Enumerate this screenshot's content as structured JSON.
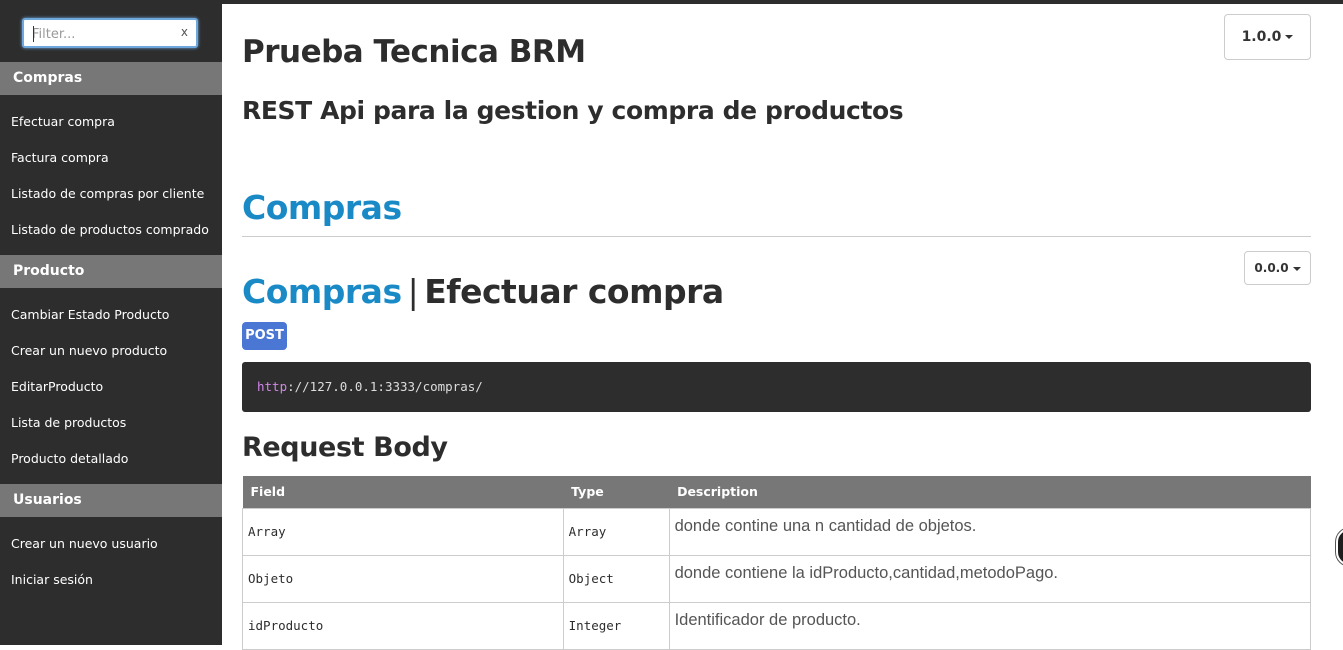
{
  "sidebar": {
    "filter_placeholder": "Filter...",
    "filter_clear": "x",
    "groups": [
      {
        "title": "Compras",
        "items": [
          "Efectuar compra",
          "Factura compra",
          "Listado de compras por cliente",
          "Listado de productos comprado"
        ]
      },
      {
        "title": "Producto",
        "items": [
          "Cambiar Estado Producto",
          "Crear un nuevo producto",
          "EditarProducto",
          "Lista de productos",
          "Producto detallado"
        ]
      },
      {
        "title": "Usuarios",
        "items": [
          "Crear un nuevo usuario",
          "Iniciar sesión"
        ]
      }
    ]
  },
  "header": {
    "title": "Prueba Tecnica BRM",
    "subtitle": "REST Api para la gestion y compra de productos",
    "version": "1.0.0"
  },
  "section": {
    "title": "Compras"
  },
  "endpoint": {
    "group": "Compras",
    "separator": "|",
    "name": "Efectuar compra",
    "version": "0.0.0",
    "method": "POST",
    "url_scheme": "http",
    "url_rest": "://127.0.0.1:3333/compras/",
    "request_body_title": "Request Body",
    "table": {
      "headers": [
        "Field",
        "Type",
        "Description"
      ],
      "rows": [
        {
          "field": "Array",
          "type": "Array",
          "description": "donde contine una n cantidad de objetos."
        },
        {
          "field": "Objeto",
          "type": "Object",
          "description": "donde contiene la idProducto,cantidad,metodoPago."
        },
        {
          "field": "idProducto",
          "type": "Integer",
          "description": "Identificador de producto."
        }
      ]
    }
  },
  "colors": {
    "sidebar_bg": "#2d2d2d",
    "group_header_bg": "#777777",
    "accent_blue": "#1a8ac7",
    "method_badge": "#4a76d4",
    "url_scheme": "#d187e6"
  }
}
